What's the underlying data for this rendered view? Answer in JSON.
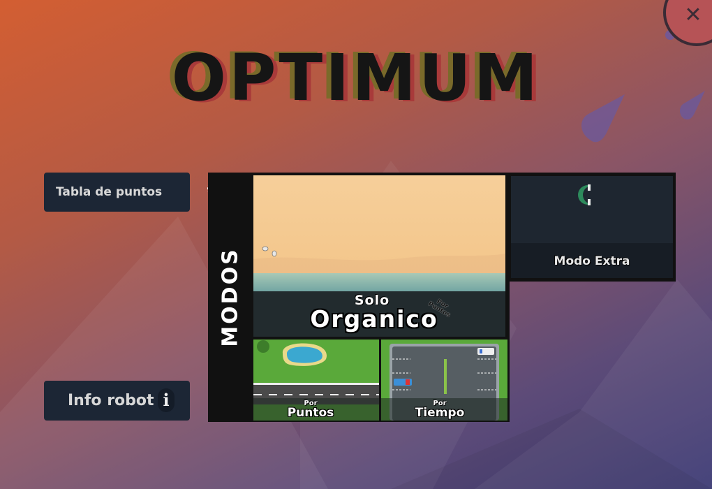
{
  "title": "OPTIMUM",
  "close_icon": "close-icon",
  "left_menu": {
    "tabla_label": "Tabla de puntos",
    "tabla_icon": "ribbon-award-icon",
    "info_label": "Info robot",
    "info_icon": "info-icon"
  },
  "modes": {
    "header": "MODOS",
    "organic": {
      "prefix": "Solo",
      "title": "Organico",
      "tag": "Por Puntos"
    },
    "puntos": {
      "prefix": "Por",
      "title": "Puntos"
    },
    "tiempo": {
      "prefix": "Por",
      "title": "Tiempo"
    },
    "extra": {
      "title": "Modo Extra"
    }
  },
  "colors": {
    "panel_dark": "#1c2635",
    "close_red": "#b65356",
    "grass": "#5aa93a",
    "sand": "#f3c68b"
  }
}
